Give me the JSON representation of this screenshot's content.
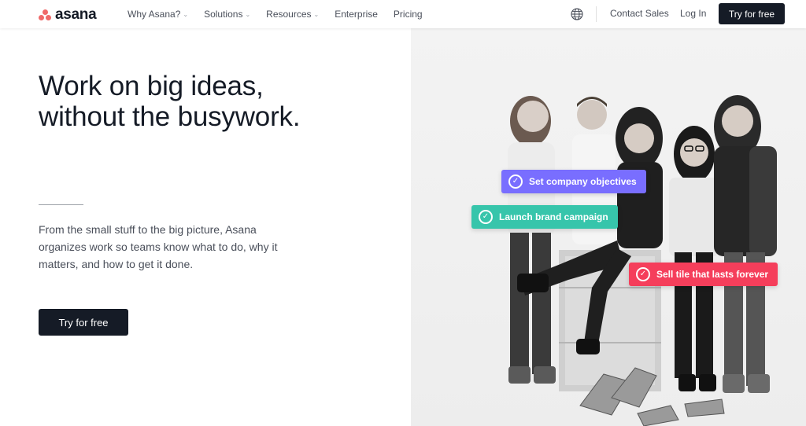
{
  "header": {
    "logo_text": "asana",
    "nav": [
      {
        "label": "Why Asana?",
        "dropdown": true
      },
      {
        "label": "Solutions",
        "dropdown": true
      },
      {
        "label": "Resources",
        "dropdown": true
      },
      {
        "label": "Enterprise",
        "dropdown": false
      },
      {
        "label": "Pricing",
        "dropdown": false
      }
    ],
    "language_icon": "globe-icon",
    "contact_sales": "Contact Sales",
    "login": "Log In",
    "cta": "Try for free"
  },
  "hero": {
    "title_line1": "Work on big ideas,",
    "title_line2": "without the busywork.",
    "subtitle": "From the small stuff to the big picture, Asana organizes work so teams know what to do, why it matters, and how to get it done.",
    "cta": "Try for free"
  },
  "tasks": [
    {
      "label": "Set company objectives",
      "color": "#796eff"
    },
    {
      "label": "Launch brand campaign",
      "color": "#37c5ab"
    },
    {
      "label": "Sell tile that lasts forever",
      "color": "#f53e5b"
    }
  ],
  "colors": {
    "brand_coral": "#f06a6a",
    "dark": "#151b26",
    "text_gray": "#4a4f5a"
  }
}
